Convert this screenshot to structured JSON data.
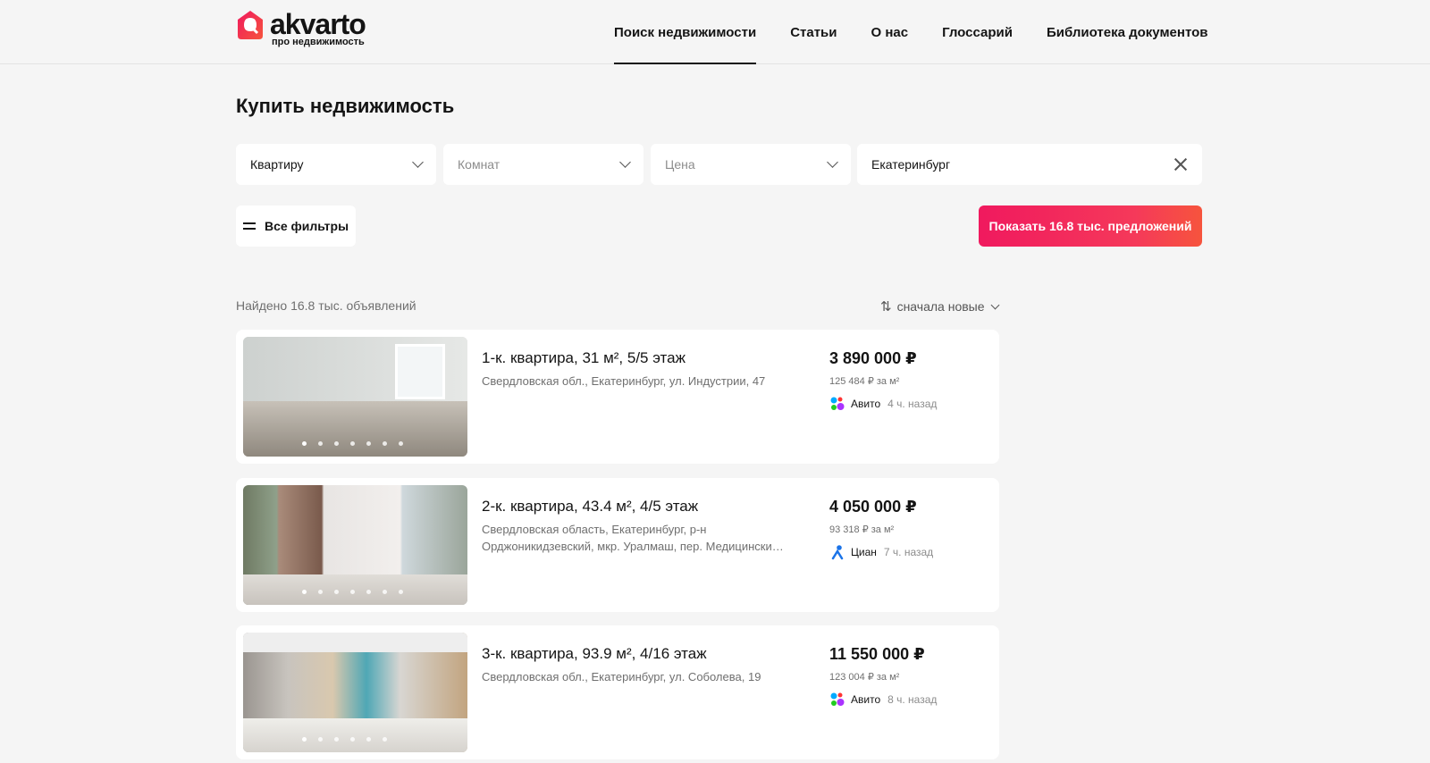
{
  "header": {
    "logo": {
      "name": "akvarto",
      "tagline": "про недвижимость"
    },
    "nav": [
      {
        "label": "Поиск недвижимости",
        "active": true
      },
      {
        "label": "Статьи"
      },
      {
        "label": "О нас"
      },
      {
        "label": "Глоссарий"
      },
      {
        "label": "Библиотека документов"
      }
    ]
  },
  "title": "Купить недвижимость",
  "filters": {
    "type": {
      "value": "Квартиру"
    },
    "rooms": {
      "placeholder": "Комнат"
    },
    "price": {
      "placeholder": "Цена"
    },
    "city": {
      "value": "Екатеринбург"
    },
    "all_filters_label": "Все фильтры",
    "show_button_label": "Показать 16.8 тыс. предложений"
  },
  "results": {
    "found_label": "Найдено 16.8 тыс. объявлений",
    "sort_label": "сначала новые"
  },
  "listings": [
    {
      "title": "1-к. квартира, 31 м², 5/5 этаж",
      "address": "Свердловская обл., Екатеринбург, ул. Индустрии, 47",
      "price": "3 890 000 ₽",
      "price_per_m2": "125 484 ₽ за м²",
      "source": "Авито",
      "source_icon": "avito-icon",
      "time": "4 ч. назад",
      "photo_count": 7,
      "active_photo": 1
    },
    {
      "title": "2-к. квартира, 43.4 м², 4/5 этаж",
      "address": "Свердловская область, Екатеринбург, р-н Орджоникидзевский, мкр. Уралмаш, пер. Медицински…",
      "price": "4 050 000 ₽",
      "price_per_m2": "93 318 ₽ за м²",
      "source": "Циан",
      "source_icon": "cian-icon",
      "time": "7 ч. назад",
      "photo_count": 7,
      "active_photo": 1
    },
    {
      "title": "3-к. квартира, 93.9 м², 4/16 этаж",
      "address": "Свердловская обл., Екатеринбург, ул. Соболева, 19",
      "price": "11 550 000 ₽",
      "price_per_m2": "123 004 ₽ за м²",
      "source": "Авито",
      "source_icon": "avito-icon",
      "time": "8 ч. назад",
      "photo_count": 6,
      "active_photo": 1
    }
  ],
  "colors": {
    "brand": "#f0195e",
    "accent_end": "#f6543d",
    "background": "#f5f5f5"
  }
}
